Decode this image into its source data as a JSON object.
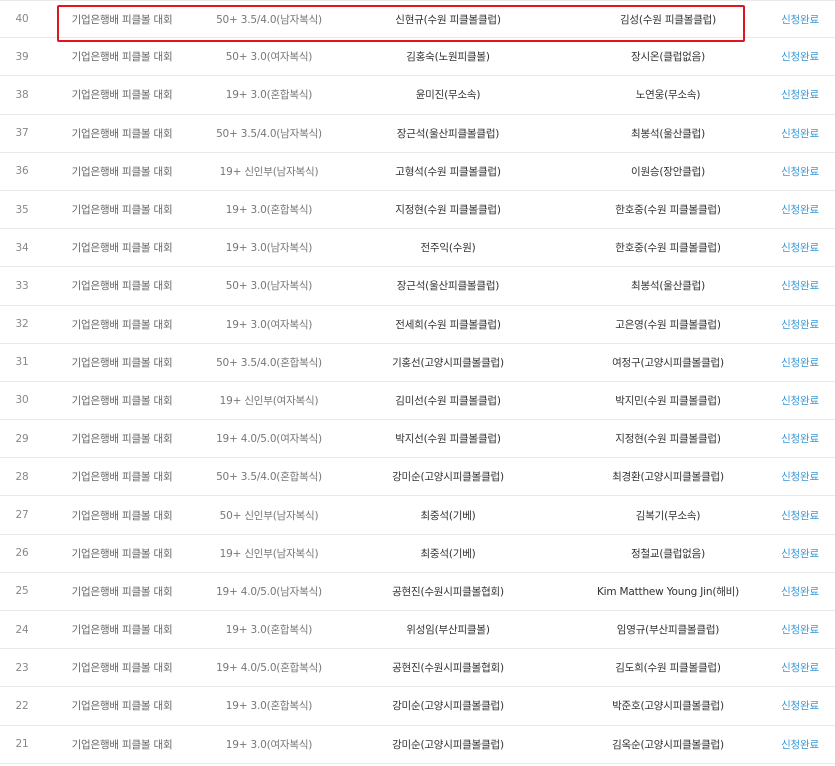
{
  "colors": {
    "highlight": "#e0161c",
    "status_link": "#3a9ad9",
    "divider": "#e9e9e9"
  },
  "rows": [
    {
      "no": "40",
      "event": "기업은행배 피클볼 대회",
      "division": "50+ 3.5/4.0(남자복식)",
      "player1": "신현규(수원 피클볼클럽)",
      "player2": "김성(수원 피클볼클럽)",
      "status": "신청완료"
    },
    {
      "no": "39",
      "event": "기업은행배 피클볼 대회",
      "division": "50+ 3.0(여자복식)",
      "player1": "김홍숙(노원피클볼)",
      "player2": "장시온(클럽없음)",
      "status": "신청완료"
    },
    {
      "no": "38",
      "event": "기업은행배 피클볼 대회",
      "division": "19+ 3.0(혼합복식)",
      "player1": "윤미진(무소속)",
      "player2": "노연웅(무소속)",
      "status": "신청완료"
    },
    {
      "no": "37",
      "event": "기업은행배 피클볼 대회",
      "division": "50+ 3.5/4.0(남자복식)",
      "player1": "장근석(울산피클볼클럽)",
      "player2": "최봉석(울산클럽)",
      "status": "신청완료"
    },
    {
      "no": "36",
      "event": "기업은행배 피클볼 대회",
      "division": "19+ 신인부(남자복식)",
      "player1": "고형석(수원 피클볼클럽)",
      "player2": "이원승(장안클럽)",
      "status": "신청완료"
    },
    {
      "no": "35",
      "event": "기업은행배 피클볼 대회",
      "division": "19+ 3.0(혼합복식)",
      "player1": "지정현(수원 피클볼클럽)",
      "player2": "한호중(수원 피클볼클럽)",
      "status": "신청완료"
    },
    {
      "no": "34",
      "event": "기업은행배 피클볼 대회",
      "division": "19+ 3.0(남자복식)",
      "player1": "전주익(수원)",
      "player2": "한호중(수원 피클볼클럽)",
      "status": "신청완료"
    },
    {
      "no": "33",
      "event": "기업은행배 피클볼 대회",
      "division": "50+ 3.0(남자복식)",
      "player1": "장근석(울산피클볼클럽)",
      "player2": "최봉석(울산클럽)",
      "status": "신청완료"
    },
    {
      "no": "32",
      "event": "기업은행배 피클볼 대회",
      "division": "19+ 3.0(여자복식)",
      "player1": "전세희(수원 피클볼클럽)",
      "player2": "고은영(수원 피클볼클럽)",
      "status": "신청완료"
    },
    {
      "no": "31",
      "event": "기업은행배 피클볼 대회",
      "division": "50+ 3.5/4.0(혼합복식)",
      "player1": "기홍선(고양시피클볼클럽)",
      "player2": "여정구(고양시피클볼클럽)",
      "status": "신청완료"
    },
    {
      "no": "30",
      "event": "기업은행배 피클볼 대회",
      "division": "19+ 신인부(여자복식)",
      "player1": "김미선(수원 피클볼클럽)",
      "player2": "박지민(수원 피클볼클럽)",
      "status": "신청완료"
    },
    {
      "no": "29",
      "event": "기업은행배 피클볼 대회",
      "division": "19+ 4.0/5.0(여자복식)",
      "player1": "박지선(수원 피클볼클럽)",
      "player2": "지정현(수원 피클볼클럽)",
      "status": "신청완료"
    },
    {
      "no": "28",
      "event": "기업은행배 피클볼 대회",
      "division": "50+ 3.5/4.0(혼합복식)",
      "player1": "강미순(고양시피클볼클럽)",
      "player2": "최경환(고양시피클볼클럽)",
      "status": "신청완료"
    },
    {
      "no": "27",
      "event": "기업은행배 피클볼 대회",
      "division": "50+ 신인부(남자복식)",
      "player1": "최중석(기베)",
      "player2": "김복기(무소속)",
      "status": "신청완료"
    },
    {
      "no": "26",
      "event": "기업은행배 피클볼 대회",
      "division": "19+ 신인부(남자복식)",
      "player1": "최중석(기베)",
      "player2": "정철교(클럽없음)",
      "status": "신청완료"
    },
    {
      "no": "25",
      "event": "기업은행배 피클볼 대회",
      "division": "19+ 4.0/5.0(남자복식)",
      "player1": "공현진(수원시피클볼협회)",
      "player2": "Kim Matthew Young Jin(해비)",
      "status": "신청완료"
    },
    {
      "no": "24",
      "event": "기업은행배 피클볼 대회",
      "division": "19+ 3.0(혼합복식)",
      "player1": "위성임(부산피클볼)",
      "player2": "임영규(부산피클볼클럽)",
      "status": "신청완료"
    },
    {
      "no": "23",
      "event": "기업은행배 피클볼 대회",
      "division": "19+ 4.0/5.0(혼합복식)",
      "player1": "공현진(수원시피클볼협회)",
      "player2": "김도희(수원 피클볼클럽)",
      "status": "신청완료"
    },
    {
      "no": "22",
      "event": "기업은행배 피클볼 대회",
      "division": "19+ 3.0(혼합복식)",
      "player1": "강미순(고양시피클볼클럽)",
      "player2": "박준호(고양시피클볼클럽)",
      "status": "신청완료"
    },
    {
      "no": "21",
      "event": "기업은행배 피클볼 대회",
      "division": "19+ 3.0(여자복식)",
      "player1": "강미순(고양시피클볼클럽)",
      "player2": "김옥순(고양시피클볼클럽)",
      "status": "신청완료"
    }
  ]
}
